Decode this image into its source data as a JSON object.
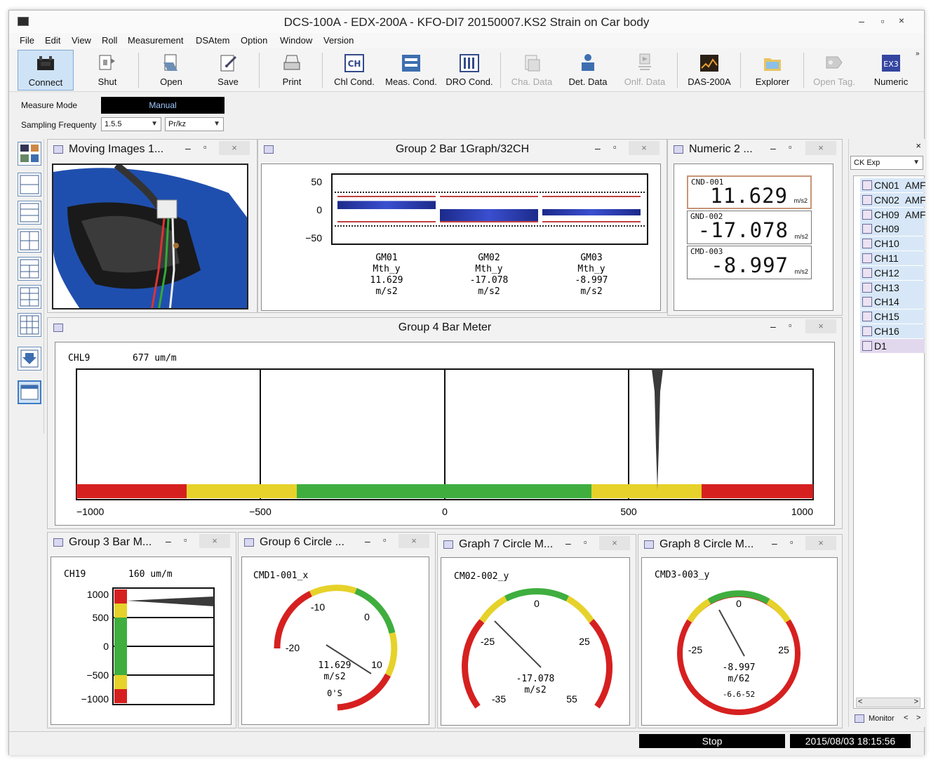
{
  "window": {
    "title": "DCS-100A - EDX-200A - KFO-DI7 20150007.KS2 Strain on Car body",
    "min": "–",
    "max": "▫",
    "close": "×"
  },
  "menu": [
    "File",
    "Edit",
    "View",
    "Roll",
    "Measurement",
    "DSAtem",
    "Option",
    "Window",
    "Version"
  ],
  "toolbar": {
    "items": [
      {
        "label": "Connect",
        "icon": "connect-icon",
        "active": true
      },
      {
        "label": "Shut",
        "icon": "shut-icon"
      },
      {
        "label": "Open",
        "icon": "open-icon"
      },
      {
        "label": "Save",
        "icon": "save-icon"
      },
      {
        "label": "Print",
        "icon": "print-icon"
      },
      {
        "label": "Chl Cond.",
        "icon": "channel-condition-icon",
        "glyph": "CH"
      },
      {
        "label": "Meas. Cond.",
        "icon": "measurement-condition-icon"
      },
      {
        "label": "DRO Cond.",
        "icon": "dro-condition-icon"
      },
      {
        "label": "Cha. Data",
        "icon": "channel-data-icon",
        "disabled": true
      },
      {
        "label": "Det. Data",
        "icon": "detail-data-icon"
      },
      {
        "label": "Onlf. Data",
        "icon": "online-data-icon",
        "disabled": true
      },
      {
        "label": "DAS-200A",
        "icon": "das-icon"
      },
      {
        "label": "Explorer",
        "icon": "explorer-icon"
      },
      {
        "label": "Open Tag.",
        "icon": "open-tag-icon",
        "disabled": true
      },
      {
        "label": "Numeric",
        "icon": "numeric-icon",
        "glyph": "EX3"
      }
    ],
    "more": "»"
  },
  "controls": {
    "measure_mode_label": "Measure Mode",
    "measure_mode_value": "Manual",
    "sampling_label": "Sampling Frequenty",
    "sampling_value": "1.5.5",
    "sampling_unit": "Pr/kz"
  },
  "panels": {
    "moving_images": {
      "title": "Moving Images 1..."
    },
    "group2": {
      "title": "Group 2 Bar 1Graph/32CH",
      "yticks": [
        "50",
        "0",
        "−50"
      ],
      "bars": [
        {
          "name": "GM01",
          "sub": "Mth_y",
          "value": "11.629",
          "unit": "m/s2"
        },
        {
          "name": "GM02",
          "sub": "Mth_y",
          "value": "-17.078",
          "unit": "m/s2"
        },
        {
          "name": "GM03",
          "sub": "Mth_y",
          "value": "-8.997",
          "unit": "m/s2"
        }
      ]
    },
    "numeric2": {
      "title": "Numeric 2 ...",
      "items": [
        {
          "label": "CND-001",
          "value": "11.629",
          "unit": "m/s2"
        },
        {
          "label": "GND-002",
          "value": "-17.078",
          "unit": "m/s2"
        },
        {
          "label": "CMD-003",
          "value": "-8.997",
          "unit": "m/s2"
        }
      ]
    },
    "group4": {
      "title": "Group 4 Bar Meter",
      "channel": "CHL9",
      "reading": "677 um/m",
      "ticks": [
        "−1000",
        "−500",
        "0",
        "500",
        "1000"
      ]
    },
    "group3": {
      "title": "Group 3 Bar M...",
      "channel": "CH19",
      "reading": "160 um/m",
      "ticks": [
        "1000",
        "500",
        "0",
        "−500",
        "−1000"
      ]
    },
    "group6": {
      "title": "Group 6 Circle ...",
      "channel": "CMD1-001_x",
      "ticks": [
        "-10",
        "0",
        "-20",
        "10"
      ],
      "value": "11.629",
      "unit": "m/s2",
      "extra": "0'S"
    },
    "graph7": {
      "title": "Graph 7 Circle M...",
      "channel": "CM02-002_y",
      "ticks": [
        "0",
        "-25",
        "25",
        "-35",
        "55"
      ],
      "value": "-17.078",
      "unit": "m/s2"
    },
    "graph8": {
      "title": "Graph 8 Circle M...",
      "channel": "CMD3-003_y",
      "ticks": [
        "0",
        "-25",
        "25"
      ],
      "value": "-8.997",
      "unit": "m/62",
      "extra": "-6.6-52"
    }
  },
  "channel_list": {
    "close": "×",
    "dropdown": "CK Exp",
    "rows": [
      {
        "name": "CN01",
        "suffix": "AMF"
      },
      {
        "name": "CN02",
        "suffix": "AMF"
      },
      {
        "name": "CH09",
        "suffix": "AMF"
      },
      {
        "name": "CH09",
        "suffix": ""
      },
      {
        "name": "CH10",
        "suffix": ""
      },
      {
        "name": "CH11",
        "suffix": ""
      },
      {
        "name": "CH12",
        "suffix": ""
      },
      {
        "name": "CH13",
        "suffix": ""
      },
      {
        "name": "CH14",
        "suffix": ""
      },
      {
        "name": "CH15",
        "suffix": ""
      },
      {
        "name": "CH16",
        "suffix": ""
      },
      {
        "name": "D1",
        "suffix": "",
        "digital": true
      }
    ],
    "monitor": "Monitor",
    "scroll_left": "<",
    "scroll_right": ">"
  },
  "status": {
    "state": "Stop",
    "datetime": "2015/08/03 18:15:56"
  },
  "colors": {
    "red": "#d62020",
    "yellow": "#e6d22a",
    "green": "#3fae3f",
    "bar_blue": "#1c2a8a",
    "selection": "#cfe3f6"
  }
}
